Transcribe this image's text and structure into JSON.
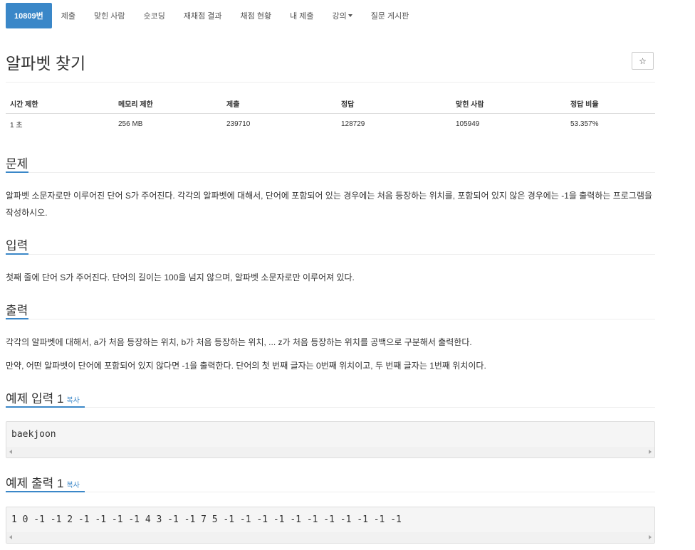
{
  "nav": {
    "tabs": [
      "10809번",
      "제출",
      "맞힌 사람",
      "숏코딩",
      "재채점 결과",
      "채점 현황",
      "내 제출",
      "강의",
      "질문 게시판"
    ]
  },
  "title": "알파벳 찾기",
  "star_icon": "☆",
  "info": {
    "headers": [
      "시간 제한",
      "메모리 제한",
      "제출",
      "정답",
      "맞힌 사람",
      "정답 비율"
    ],
    "values": [
      "1 초",
      "256 MB",
      "239710",
      "128729",
      "105949",
      "53.357%"
    ]
  },
  "sections": {
    "problem": {
      "title": "문제",
      "text": "알파벳 소문자로만 이루어진 단어 S가 주어진다. 각각의 알파벳에 대해서, 단어에 포함되어 있는 경우에는 처음 등장하는 위치를, 포함되어 있지 않은 경우에는 -1을 출력하는 프로그램을 작성하시오."
    },
    "input": {
      "title": "입력",
      "text": "첫째 줄에 단어 S가 주어진다. 단어의 길이는 100을 넘지 않으며, 알파벳 소문자로만 이루어져 있다."
    },
    "output": {
      "title": "출력",
      "text1": "각각의 알파벳에 대해서, a가 처음 등장하는 위치, b가 처음 등장하는 위치, ... z가 처음 등장하는 위치를 공백으로 구분해서 출력한다.",
      "text2": "만약, 어떤 알파벳이 단어에 포함되어 있지 않다면 -1을 출력한다. 단어의 첫 번째 글자는 0번째 위치이고, 두 번째 글자는 1번째 위치이다."
    },
    "sample_input": {
      "title": "예제 입력 1",
      "copy": "복사",
      "content": "baekjoon"
    },
    "sample_output": {
      "title": "예제 출력 1",
      "copy": "복사",
      "content": "1 0 -1 -1 2 -1 -1 -1 -1 4 3 -1 -1 7 5 -1 -1 -1 -1 -1 -1 -1 -1 -1 -1 -1"
    }
  },
  "colors": {
    "accent": "#3a87c8"
  }
}
